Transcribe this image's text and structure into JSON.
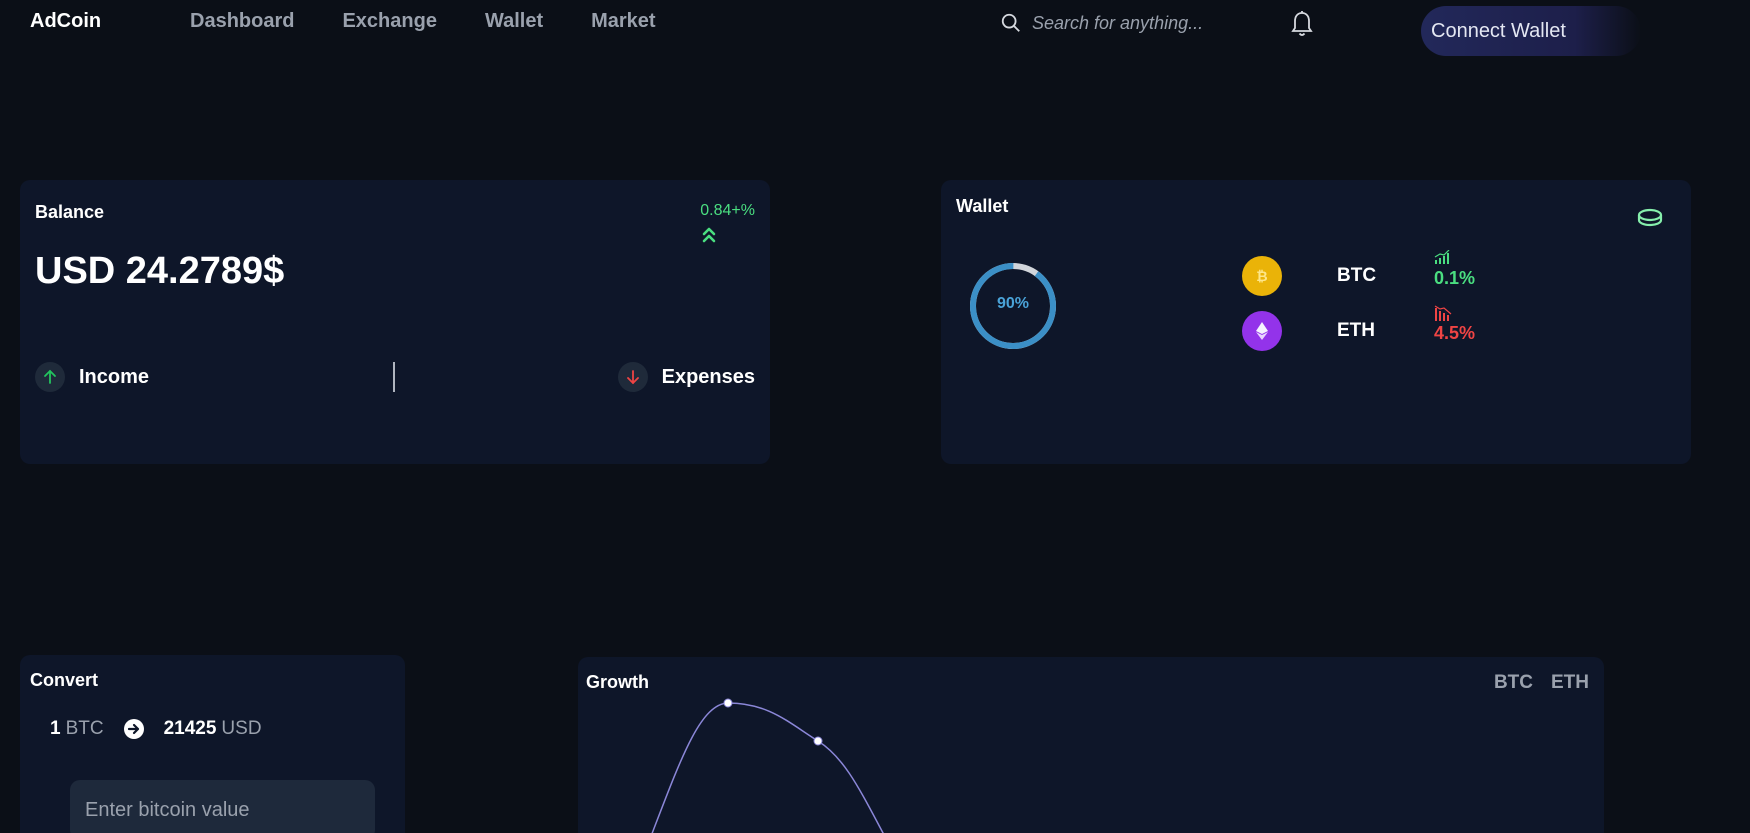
{
  "brand": {
    "logo": "AdCoin"
  },
  "nav": {
    "items": [
      "Dashboard",
      "Exchange",
      "Wallet",
      "Market"
    ]
  },
  "search": {
    "placeholder": "Search for anything..."
  },
  "header": {
    "connect_label": "Connect Wallet"
  },
  "balance": {
    "title": "Balance",
    "amount": "USD 24.2789$",
    "change": "0.84+%",
    "income_label": "Income",
    "expenses_label": "Expenses"
  },
  "wallet": {
    "title": "Wallet",
    "ring_percent": 90,
    "ring_label": "90%",
    "coins": [
      {
        "symbol": "BTC",
        "pct": "0.1%",
        "direction": "up",
        "color": "#eab308"
      },
      {
        "symbol": "ETH",
        "pct": "4.5%",
        "direction": "down",
        "color": "#9333ea"
      }
    ]
  },
  "convert": {
    "title": "Convert",
    "from_amount": "1",
    "from_unit": "BTC",
    "to_amount": "21425",
    "to_unit": "USD",
    "input_placeholder": "Enter bitcoin value"
  },
  "growth": {
    "title": "Growth",
    "tabs": [
      "BTC",
      "ETH"
    ]
  },
  "colors": {
    "positive": "#4ade80",
    "negative": "#ef4444",
    "ring": "#3b8fc6",
    "curve": "#8b87d8"
  }
}
